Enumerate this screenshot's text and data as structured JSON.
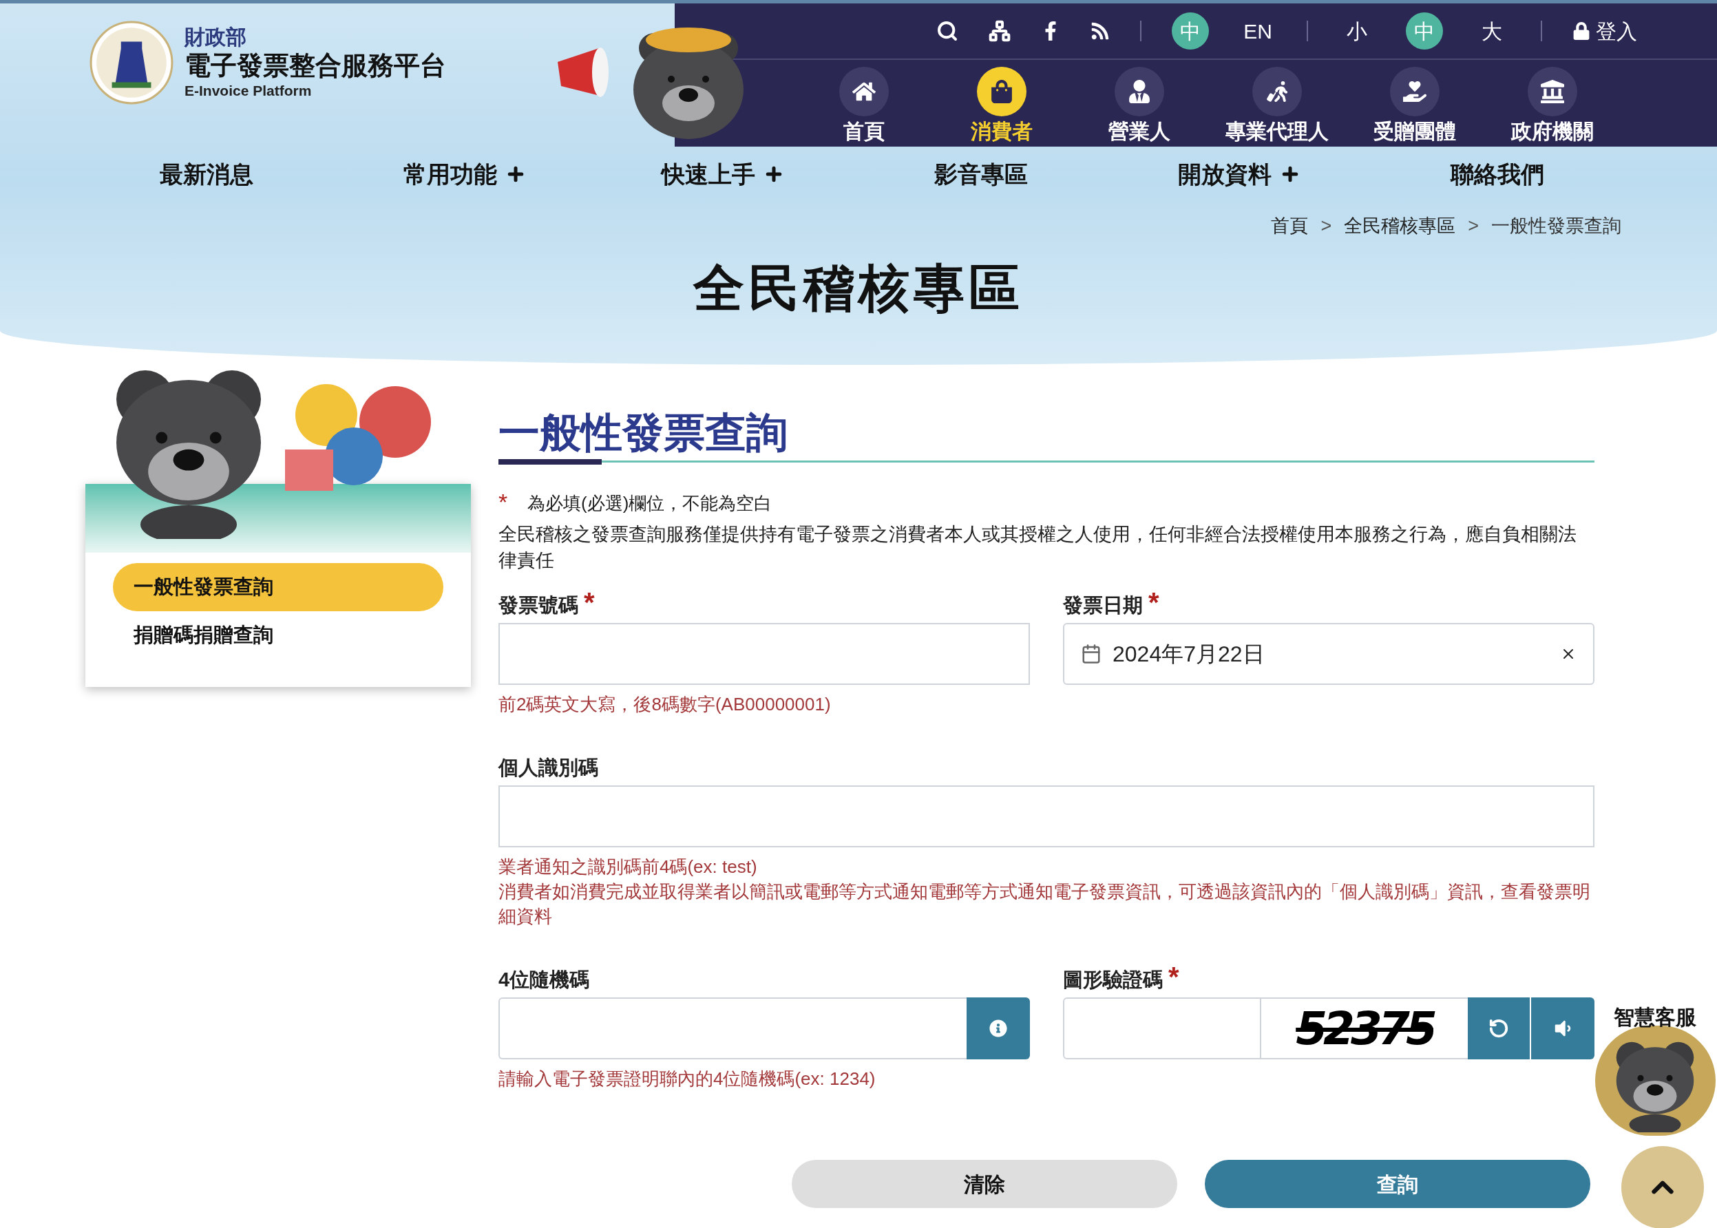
{
  "header": {
    "ministry": "財政部",
    "site_name": "電子發票整合服務平台",
    "site_name_en": "E-Invoice Platform"
  },
  "utility": {
    "languages": [
      {
        "label": "中",
        "selected": true
      },
      {
        "label": "EN",
        "selected": false
      }
    ],
    "font_sizes": [
      {
        "label": "小",
        "selected": false
      },
      {
        "label": "中",
        "selected": true
      },
      {
        "label": "大",
        "selected": false
      }
    ],
    "login": "登入"
  },
  "roles": [
    {
      "label": "首頁",
      "selected": false
    },
    {
      "label": "消費者",
      "selected": true
    },
    {
      "label": "營業人",
      "selected": false
    },
    {
      "label": "專業代理人",
      "selected": false
    },
    {
      "label": "受贈團體",
      "selected": false
    },
    {
      "label": "政府機關",
      "selected": false
    }
  ],
  "main_nav": [
    {
      "label": "最新消息",
      "has_submenu": false
    },
    {
      "label": "常用功能",
      "has_submenu": true
    },
    {
      "label": "快速上手",
      "has_submenu": true
    },
    {
      "label": "影音專區",
      "has_submenu": false
    },
    {
      "label": "開放資料",
      "has_submenu": true
    },
    {
      "label": "聯絡我們",
      "has_submenu": false
    }
  ],
  "breadcrumb": {
    "separator": ">",
    "items": [
      "首頁",
      "全民稽核專區",
      "一般性發票查詢"
    ]
  },
  "page_title": "全民稽核專區",
  "sidebar": {
    "items": [
      {
        "label": "一般性發票查詢",
        "selected": true
      },
      {
        "label": "捐贈碼捐贈查詢",
        "selected": false
      }
    ]
  },
  "form": {
    "heading": "一般性發票查詢",
    "required_mark": "*",
    "required_note": "為必填(必選)欄位，不能為空白",
    "disclaimer": "全民稽核之發票查詢服務僅提供持有電子發票之消費者本人或其授權之人使用，任何非經合法授權使用本服務之行為，應自負相關法律責任",
    "rows": [
      [
        {
          "kind": "text",
          "label": "發票號碼",
          "mark": "*",
          "hints": [
            "前2碼英文大寫，後8碼數字(AB00000001)"
          ]
        },
        {
          "kind": "date",
          "label": "發票日期",
          "mark": "*",
          "value": "2024年7月22日"
        }
      ],
      [
        {
          "kind": "text",
          "label": "個人識別碼",
          "hints": [
            "業者通知之識別碼前4碼(ex: test)",
            "消費者如消費完成並取得業者以簡訊或電郵等方式通知電郵等方式通知電子發票資訊，可透過該資訊內的「個人識別碼」資訊，查看發票明細資料"
          ]
        }
      ],
      [
        {
          "kind": "info",
          "label": "4位隨機碼",
          "hints": [
            "請輸入電子發票證明聯內的4位隨機碼(ex: 1234)"
          ]
        },
        {
          "kind": "captcha",
          "label": "圖形驗證碼",
          "mark": "*",
          "code": "52375"
        }
      ]
    ],
    "buttons": [
      {
        "label": "清除",
        "kind": "secondary"
      },
      {
        "label": "查詢",
        "kind": "primary"
      }
    ]
  },
  "chatbot": {
    "label": "智慧客服"
  }
}
